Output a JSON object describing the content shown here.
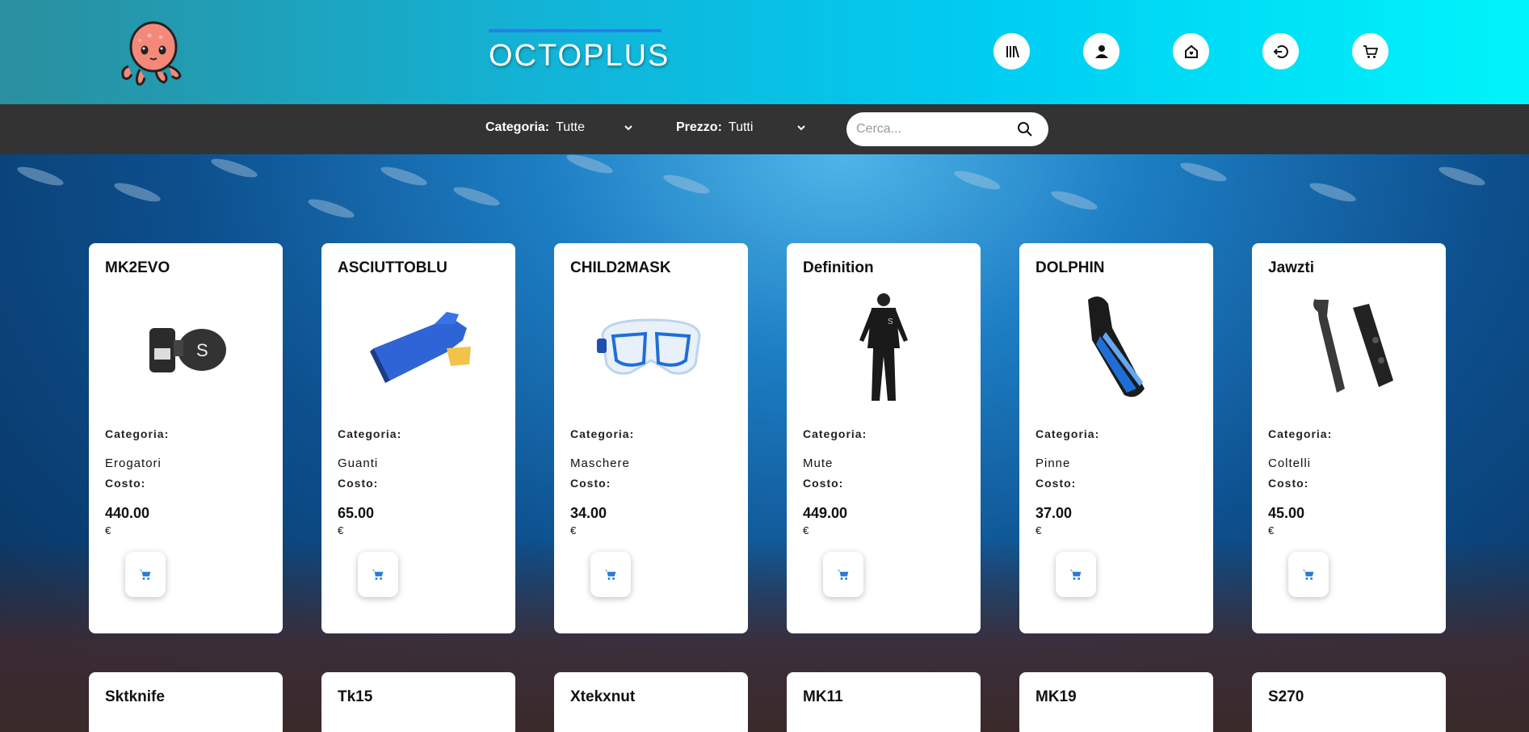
{
  "header": {
    "brand": "OCTOPLUS",
    "nav_icons": [
      "library-icon",
      "user-icon",
      "home-icon",
      "logout-icon",
      "cart-icon"
    ]
  },
  "filters": {
    "category_label": "Categoria:",
    "category_value": "Tutte",
    "price_label": "Prezzo:",
    "price_value": "Tutti"
  },
  "search": {
    "placeholder": "Cerca..."
  },
  "labels": {
    "category": "Categoria:",
    "cost": "Costo:",
    "currency": "€"
  },
  "products": [
    {
      "name": "MK2EVO",
      "category": "Erogatori",
      "price": "440.00",
      "image": "regulator"
    },
    {
      "name": "ASCIUTTOBLU",
      "category": "Guanti",
      "price": "65.00",
      "image": "glove"
    },
    {
      "name": "CHILD2MASK",
      "category": "Maschere",
      "price": "34.00",
      "image": "mask"
    },
    {
      "name": "Definition",
      "category": "Mute",
      "price": "449.00",
      "image": "wetsuit"
    },
    {
      "name": "DOLPHIN",
      "category": "Pinne",
      "price": "37.00",
      "image": "fin"
    },
    {
      "name": "Jawzti",
      "category": "Coltelli",
      "price": "45.00",
      "image": "knife"
    }
  ],
  "products_row2": [
    {
      "name": "Sktknife"
    },
    {
      "name": "Tk15"
    },
    {
      "name": "Xtekxnut"
    },
    {
      "name": "MK11"
    },
    {
      "name": "MK19"
    },
    {
      "name": "S270"
    }
  ],
  "colors": {
    "header_start": "#2a8f9e",
    "header_end": "#00f4fb",
    "filterbar": "#333333",
    "brand_bar": "#2b7bf0",
    "cart_accent": "#2b7bd3"
  }
}
